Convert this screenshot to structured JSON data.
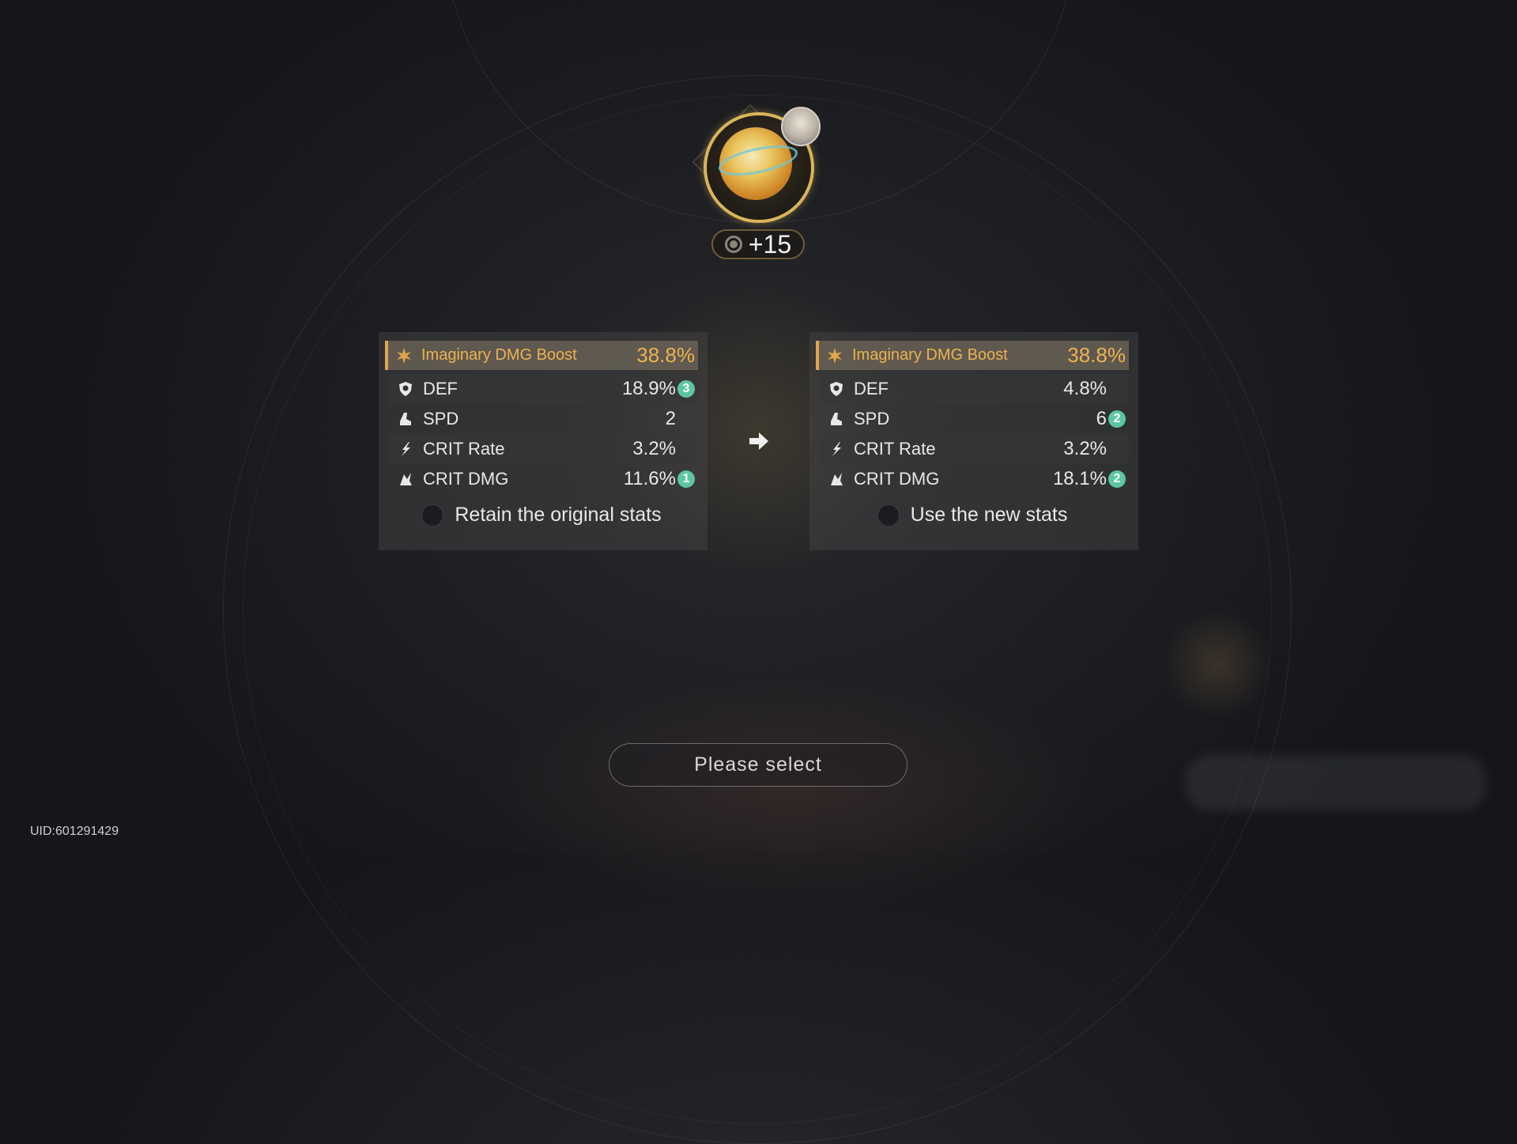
{
  "relic": {
    "level": "+15",
    "level_icon": "relic-level-icon",
    "image": "orb-relic-icon",
    "avatar": "character-avatar"
  },
  "left_panel": {
    "main_stat": {
      "name": "Imaginary DMG Boost",
      "value": "38.8%",
      "icon": "imaginary-dmg-icon"
    },
    "sub_stats": [
      {
        "name": "DEF",
        "value": "18.9%",
        "badge": "3",
        "icon": "shield-icon"
      },
      {
        "name": "SPD",
        "value": "2",
        "badge": "",
        "icon": "boot-icon"
      },
      {
        "name": "CRIT Rate",
        "value": "3.2%",
        "badge": "",
        "icon": "crit-rate-icon"
      },
      {
        "name": "CRIT DMG",
        "value": "11.6%",
        "badge": "1",
        "icon": "crit-dmg-icon"
      }
    ],
    "option_label": "Retain the original stats"
  },
  "right_panel": {
    "main_stat": {
      "name": "Imaginary DMG Boost",
      "value": "38.8%",
      "icon": "imaginary-dmg-icon"
    },
    "sub_stats": [
      {
        "name": "DEF",
        "value": "4.8%",
        "badge": "",
        "icon": "shield-icon"
      },
      {
        "name": "SPD",
        "value": "6",
        "badge": "2",
        "icon": "boot-icon"
      },
      {
        "name": "CRIT Rate",
        "value": "3.2%",
        "badge": "",
        "icon": "crit-rate-icon"
      },
      {
        "name": "CRIT DMG",
        "value": "18.1%",
        "badge": "2",
        "icon": "crit-dmg-icon"
      }
    ],
    "option_label": "Use the new stats"
  },
  "select_button": {
    "label": "Please select"
  },
  "uid": "UID:601291429",
  "colors": {
    "accent_gold": "#eeb250",
    "badge_green": "#5cc7a1"
  }
}
